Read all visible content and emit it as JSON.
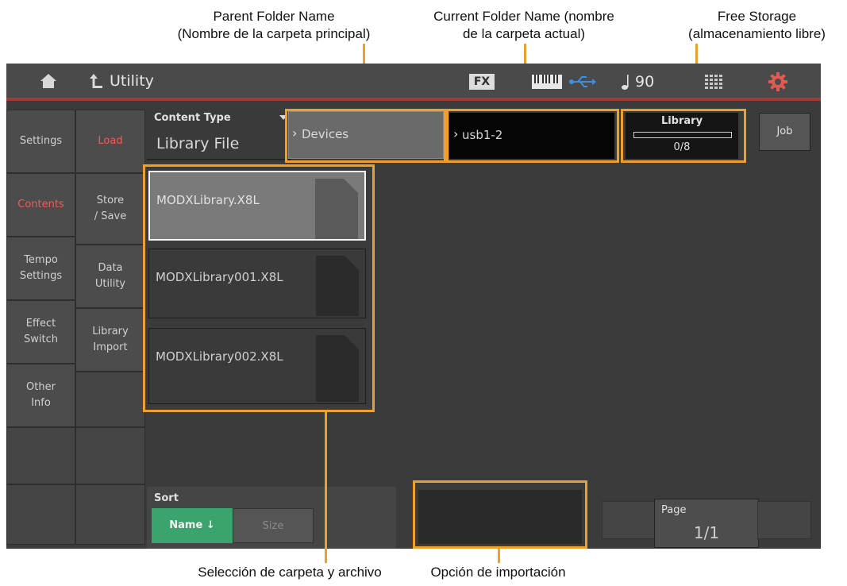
{
  "annotations": {
    "parent_folder": [
      "Parent Folder Name",
      "(Nombre de la carpeta principal)"
    ],
    "current_folder": [
      "Current Folder Name (nombre",
      "de la carpeta actual)"
    ],
    "free_storage": [
      "Free Storage",
      "(almacenamiento libre)"
    ],
    "folder_file_selection": "Selección de carpeta y archivo",
    "import_option": "Opción de importación"
  },
  "topbar": {
    "home_icon": "home-icon",
    "back_icon": "back-arrow-icon",
    "title": "Utility",
    "fx_label": "FX",
    "keyboard_icon": "keyboard-icon",
    "usb_icon": "usb-icon",
    "tempo_icon": "note-icon",
    "tempo": "90",
    "grid_icon": "grid-icon",
    "settings_icon": "gear-icon"
  },
  "left_tabs": [
    {
      "label": "Settings",
      "selected": false
    },
    {
      "label": "Contents",
      "selected": true
    },
    {
      "label": "Tempo\nSettings",
      "selected": false
    },
    {
      "label": "Effect\nSwitch",
      "selected": false
    },
    {
      "label": "Other\nInfo",
      "selected": false
    }
  ],
  "sub_tabs": [
    {
      "label": "Load",
      "selected": true
    },
    {
      "label": "Store\n/ Save",
      "selected": false
    },
    {
      "label": "Data\nUtility",
      "selected": false
    },
    {
      "label": "Library\nImport",
      "selected": false
    }
  ],
  "content_type": {
    "label": "Content Type",
    "value": "Library File"
  },
  "parent_folder_value": "Devices",
  "current_folder_value": "usb1-2",
  "storage": {
    "label": "Library",
    "value": "0/8",
    "fill": 0
  },
  "job_label": "Job",
  "files": [
    {
      "name": "MODXLibrary.X8L",
      "selected": true
    },
    {
      "name": "MODXLibrary001.X8L",
      "selected": false
    },
    {
      "name": "MODXLibrary002.X8L",
      "selected": false
    }
  ],
  "sort": {
    "label": "Sort",
    "name_label": "Name ↓",
    "size_label": "Size"
  },
  "page": {
    "label": "Page",
    "value": "1/1"
  },
  "colors": {
    "accent": "#f05a5a",
    "annotation": "#f0a028",
    "sort_active": "#3aa36e"
  }
}
